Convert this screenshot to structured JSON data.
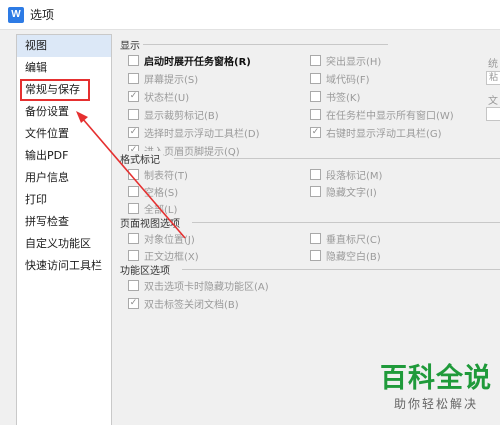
{
  "window": {
    "title": "选项",
    "app_icon_glyph": "W"
  },
  "sidebar": {
    "items": [
      {
        "label": "视图",
        "selected": true
      },
      {
        "label": "编辑"
      },
      {
        "label": "常规与保存",
        "highlighted": true
      },
      {
        "label": "备份设置"
      },
      {
        "label": "文件位置"
      },
      {
        "label": "输出PDF"
      },
      {
        "label": "用户信息"
      },
      {
        "label": "打印"
      },
      {
        "label": "拼写检查"
      },
      {
        "label": "自定义功能区"
      },
      {
        "label": "快速访问工具栏"
      }
    ]
  },
  "groups": {
    "display": {
      "label": "显示",
      "options": {
        "startup_taskpane": "启动时展开任务窗格(R)",
        "screen_tips": "屏幕提示(S)",
        "status_bar": "状态栏(U)",
        "crop_marks": "显示裁剪标记(B)",
        "float_toolbar": "选择时显示浮动工具栏(D)",
        "header_footer": "进入页眉页脚提示(Q)",
        "highlight": "突出显示(H)",
        "field_codes": "域代码(F)",
        "bookmarks": "书签(K)",
        "taskbar_windows": "在任务栏中显示所有窗口(W)",
        "right_click_toolbar": "右键时显示浮动工具栏(G)"
      }
    },
    "format_marks": {
      "label": "格式标记",
      "options": {
        "tabs": "制表符(T)",
        "spaces": "空格(S)",
        "all": "全部(L)",
        "paragraph": "段落标记(M)",
        "hidden_text": "隐藏文字(I)"
      }
    },
    "page_view": {
      "label": "页面视图选项",
      "options": {
        "object_position": "对象位置(J)",
        "text_boundaries": "正文边框(X)",
        "vertical_ruler": "垂直标尺(C)",
        "hide_whitespace": "隐藏空白(B)"
      }
    },
    "ribbon": {
      "label": "功能区选项",
      "options": {
        "dblclick_hide": "双击选项卡时隐藏功能区(A)",
        "dblclick_close": "双击标签关闭文档(B)"
      }
    }
  },
  "right_edge": {
    "label1": "统",
    "box_text": "粘",
    "label2": "文"
  },
  "icons": {
    "check": "check-icon",
    "arrow": "red-arrow-annotation"
  },
  "colors": {
    "accent": "#2d7be5",
    "highlight_red": "#e53030",
    "selected_bg": "#dce8f7",
    "watermark_green": "#1f9a3a"
  },
  "watermark": {
    "title": "百科全说",
    "subtitle": "助你轻松解决"
  }
}
